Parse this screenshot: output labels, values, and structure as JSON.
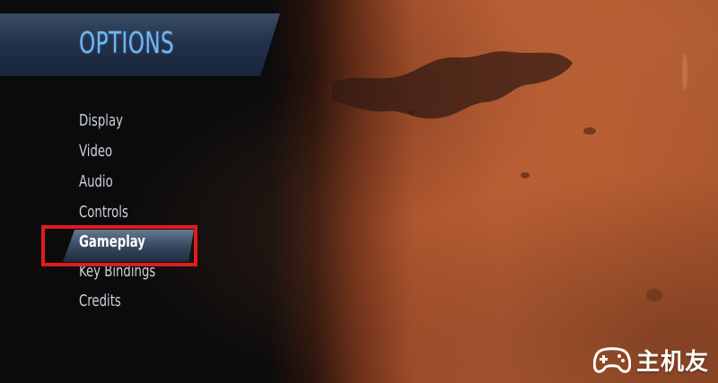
{
  "header": {
    "title": "OPTIONS"
  },
  "menu": {
    "items": [
      {
        "label": "Display"
      },
      {
        "label": "Video"
      },
      {
        "label": "Audio"
      },
      {
        "label": "Controls"
      },
      {
        "label": "Gameplay",
        "selected": true
      },
      {
        "label": "Key Bindings"
      },
      {
        "label": "Credits"
      }
    ]
  },
  "annotation": {
    "highlight_color": "#e21b1b"
  },
  "watermark": {
    "text": "主机友",
    "icon": "gamepad-icon"
  },
  "colors": {
    "title_blue": "#6fb7f2",
    "menu_text": "#c9d1da",
    "mars_orange": "#b35a32"
  }
}
